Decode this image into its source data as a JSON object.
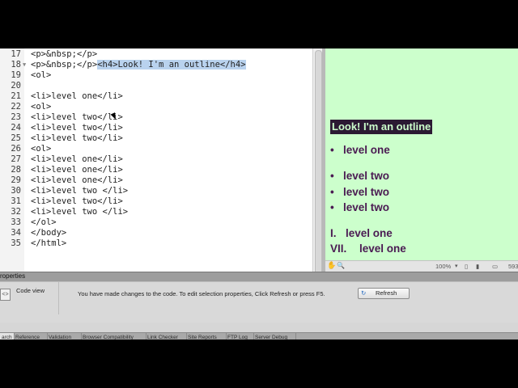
{
  "code": {
    "lines": [
      {
        "n": "17",
        "text": "<p>&nbsp;</p>"
      },
      {
        "n": "18",
        "pre": "<p>&nbsp;</p>",
        "hl": "<h4>Look! I'm an outline</h4>",
        "fold": "▼"
      },
      {
        "n": "19",
        "text": "<ol>"
      },
      {
        "n": "20",
        "text": ""
      },
      {
        "n": "21",
        "text": "<li>level one</li>"
      },
      {
        "n": "22",
        "text": "<ol>"
      },
      {
        "n": "23",
        "text": "<li>level two</li>"
      },
      {
        "n": "24",
        "text": "<li>level two</li>"
      },
      {
        "n": "25",
        "text": "<li>level two</li>"
      },
      {
        "n": "26",
        "text": "<ol>"
      },
      {
        "n": "27",
        "text": "<li>level one</li>"
      },
      {
        "n": "28",
        "text": "<li>level one</li>"
      },
      {
        "n": "29",
        "text": "<li>level one</li>"
      },
      {
        "n": "30",
        "text": "<li>level two </li>"
      },
      {
        "n": "31",
        "text": "<li>level two</li>"
      },
      {
        "n": "32",
        "text": "<li>level two </li>"
      },
      {
        "n": "33",
        "text": "</ol>"
      },
      {
        "n": "34",
        "text": "</body>"
      },
      {
        "n": "35",
        "text": "</html>"
      }
    ]
  },
  "design": {
    "heading": "Look! I'm an outline",
    "items": [
      {
        "marker": "•",
        "text": "level one"
      },
      {
        "marker": "•",
        "text": "level two"
      },
      {
        "marker": "•",
        "text": "level two"
      },
      {
        "marker": "•",
        "text": "level two"
      },
      {
        "marker": "I.",
        "text": "level one"
      },
      {
        "marker": "VII.",
        "text": "level one"
      }
    ],
    "colors": {
      "background": "#ccffcc",
      "heading_bg": "#2b1a33",
      "text": "#4a1a52"
    }
  },
  "statusbar": {
    "zoom": "100%",
    "width": "593"
  },
  "properties": {
    "header": "roperties",
    "view_label": "Code view",
    "message": "You have made changes to the code. To edit selection properties, Click Refresh or press F5.",
    "refresh_label": "Refresh"
  },
  "tabs": [
    "arch",
    "Reference",
    "Validation",
    "Browser Compatibility",
    "Link Checker",
    "Site Reports",
    "FTP Log",
    "Server Debug"
  ]
}
